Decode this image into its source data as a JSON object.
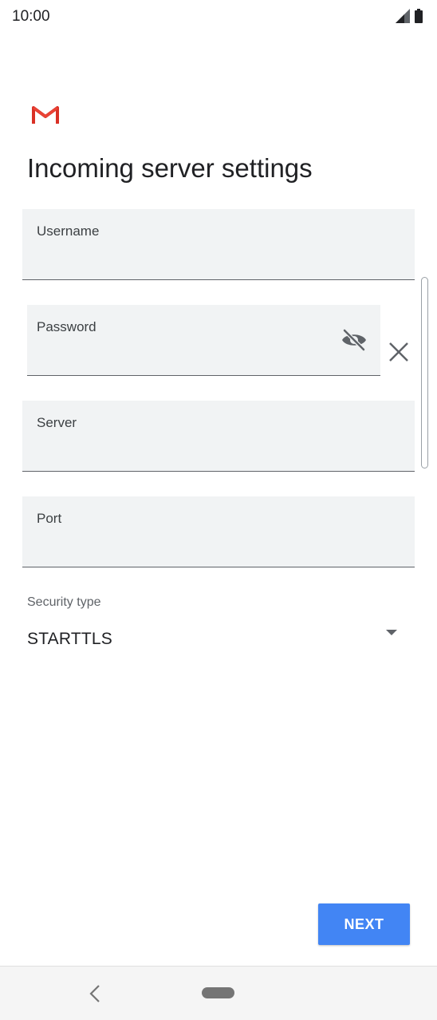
{
  "status_bar": {
    "time": "10:00",
    "icons": [
      "signal-icon",
      "battery-icon"
    ]
  },
  "app": {
    "logo": "gmail-logo-icon",
    "brand_color": "#d93025"
  },
  "page": {
    "title": "Incoming server settings"
  },
  "form": {
    "username": {
      "label": "Username",
      "value": ""
    },
    "password": {
      "label": "Password",
      "value": ""
    },
    "server": {
      "label": "Server",
      "value": ""
    },
    "port": {
      "label": "Port",
      "value": ""
    },
    "security_type": {
      "label": "Security type",
      "selected": "STARTTLS"
    }
  },
  "actions": {
    "next_label": "NEXT",
    "accent_color": "#4285f4"
  },
  "nav_bar": {
    "icons": [
      "back-icon",
      "home-pill-icon"
    ]
  }
}
